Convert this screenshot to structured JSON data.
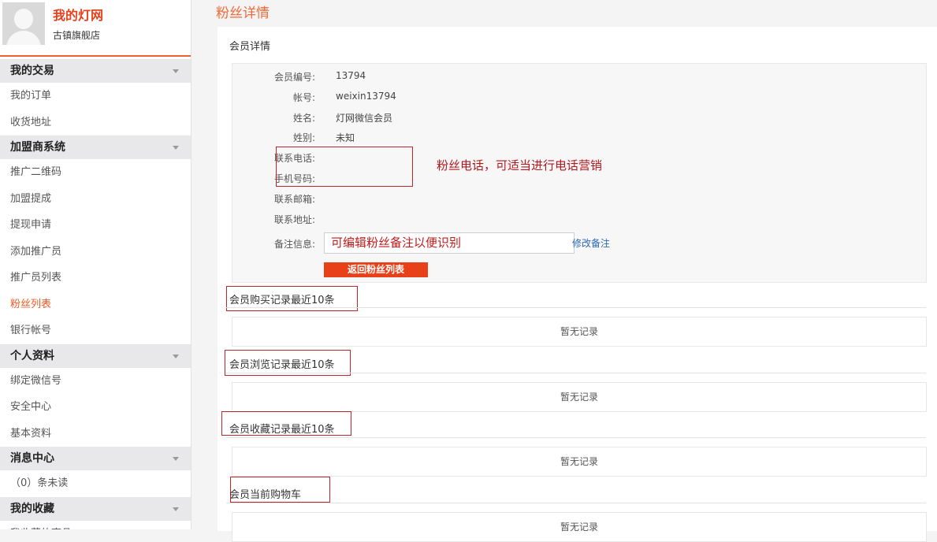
{
  "sidebar": {
    "site_name": "我的灯网",
    "shop_name": "古镇旗舰店",
    "sections": [
      {
        "title": "我的交易",
        "items": [
          "我的订单",
          "收货地址"
        ]
      },
      {
        "title": "加盟商系统",
        "items": [
          "推广二维码",
          "加盟提成",
          "提现申请",
          "添加推广员",
          "推广员列表",
          "粉丝列表",
          "银行帐号"
        ]
      },
      {
        "title": "个人资料",
        "items": [
          "绑定微信号",
          "安全中心",
          "基本资料"
        ]
      },
      {
        "title": "消息中心",
        "items": [
          "（0）条未读"
        ]
      },
      {
        "title": "我的收藏",
        "items": [
          "我收藏的商品"
        ]
      }
    ],
    "active_item": "粉丝列表"
  },
  "main": {
    "page_title": "粉丝详情",
    "panel_title": "会员详情",
    "fields": [
      {
        "label": "会员编号:",
        "value": "13794"
      },
      {
        "label": "帐号:",
        "value": "weixin13794"
      },
      {
        "label": "姓名:",
        "value": "灯网微信会员"
      },
      {
        "label": "姓别:",
        "value": "未知"
      },
      {
        "label": "联系电话:",
        "value": ""
      },
      {
        "label": "手机号码:",
        "value": ""
      },
      {
        "label": "联系邮箱:",
        "value": ""
      },
      {
        "label": "联系地址:",
        "value": ""
      }
    ],
    "note_label": "备注信息:",
    "note_value": "可编辑粉丝备注以便识别",
    "edit_note_link": "修改备注",
    "back_button": "返回粉丝列表",
    "phone_annotation": "粉丝电话，可适当进行电话营销",
    "sections": [
      {
        "title": "会员购买记录最近10条",
        "empty_text": "暂无记录"
      },
      {
        "title": "会员浏览记录最近10条",
        "empty_text": "暂无记录"
      },
      {
        "title": "会员收藏记录最近10条",
        "empty_text": "暂无记录"
      },
      {
        "title": "会员当前购物车",
        "empty_text": "暂无记录"
      }
    ]
  },
  "colors": {
    "brand": "#e8411a",
    "active_menu": "#f05a24",
    "annotation": "#c0232a",
    "link": "#2c68b3"
  }
}
